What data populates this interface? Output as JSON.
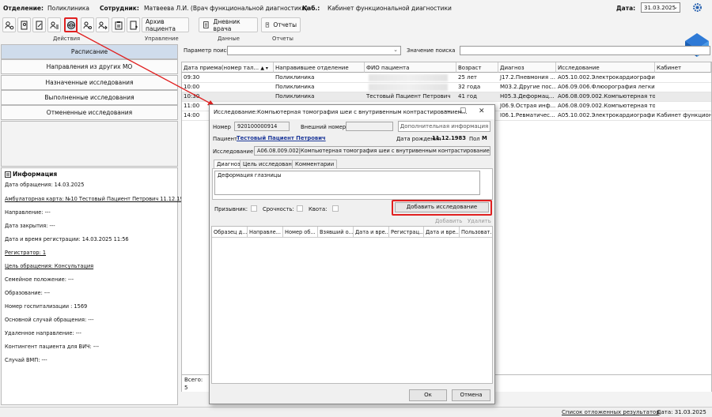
{
  "topbar": {
    "dept_label": "Отделение:",
    "dept_value": "Поликлиника",
    "emp_label": "Сотрудник:",
    "emp_value": "Матвеева Л.И. (Врач функциональной диагностики)",
    "cab_label": "Каб.:",
    "cab_value": "Кабинет функциональной диагностики",
    "date_label": "Дата:",
    "date_value": "31.03.2025"
  },
  "toolbar": {
    "groups": [
      "Действия",
      "Управление",
      "Данные",
      "Отчеты"
    ],
    "archive_label": "Архив пациента",
    "diary_label": "Дневник врача",
    "reports_label": "Отчеты"
  },
  "nav": {
    "items": [
      "Расписание",
      "Направления из других МО",
      "Назначенные исследования",
      "Выполненные исследования",
      "Отмененные исследования"
    ]
  },
  "info": {
    "header": "Информация",
    "lines": [
      "Дата обращения: 14.03.2025",
      "Амбулаторная карта: №10 Тестовый Пациент Петрович 11.12.1983",
      "Направление: ---",
      "Дата закрытия: ---",
      "Дата и время регистрации: 14.03.2025 11:56",
      "Регистратор: 1",
      "Цель обращения: Консультация",
      "Семейное положение: ---",
      "Образование: ---",
      "Номер госпитализации : 1569",
      "Основной случай обращения: ---",
      "Удаленное направление: ---",
      "Контингент пациента для ВИЧ: ---",
      "Случай ВМП: ---"
    ]
  },
  "search": {
    "param_label": "Параметр поиска",
    "value_label": "Значение поиска"
  },
  "grid": {
    "columns": [
      "Дата приема(номер тал...",
      "Направившее отделение",
      "ФИО пациента",
      "Возраст",
      "Диагноз",
      "Исследование",
      "Кабинет"
    ],
    "rows": [
      [
        "09:30",
        "Поликлиника",
        "",
        "25 лет",
        "J17.2.Пневмония ...",
        "A05.10.002.Электрокардиография",
        ""
      ],
      [
        "10:00",
        "Поликлиника",
        "",
        "32 года",
        "M03.2.Другие пос...",
        "A06.09.006.Флюорография легки...",
        ""
      ],
      [
        "10:30",
        "Поликлиника",
        "Тестовый Пациент Петрович",
        "41 год",
        "H05.3.Деформац...",
        "A06.08.009.002.Компьютерная то...",
        ""
      ],
      [
        "11:00",
        "",
        "",
        "",
        "J06.9.Острая инф...",
        "A06.08.009.002.Компьютерная то...",
        ""
      ],
      [
        "14:00",
        "",
        "",
        "",
        "I06.1.Ревматичес...",
        "A05.10.002.Электрокардиография",
        "Кабинет функцион"
      ]
    ],
    "footer_total": "Всего:",
    "footer_count": "5"
  },
  "status": {
    "link": "Список отложенных результатов",
    "date": "Дата: 31.03.2025"
  },
  "dialog": {
    "title": "Исследование:Компьютерная томография шеи с внутривенным контрастированием...",
    "number_label": "Номер",
    "number_value": "920100000914",
    "ext_label": "Внешний номер",
    "ext_value": "",
    "addinfo_btn": "Дополнительная информация",
    "patient_label": "Пациент",
    "patient_value": "Тестовый Пациент Петрович",
    "dob_label": "Дата рождения",
    "dob_value": "11.12.1983",
    "sex_label": "Пол",
    "sex_value": "М",
    "study_label": "Исследование",
    "study_value": "A06.08.009.002|Компьютерная томография шеи с внутривенным контрастированием",
    "tabs": [
      "Диагноз",
      "Цель исследования",
      "Комментарии"
    ],
    "diagnosis_text": "Деформация глазницы",
    "chk_labels": [
      "Призывник:",
      "Срочность:",
      "Квота:"
    ],
    "add_study_btn": "Добавить исследование",
    "add_link": "Добавить",
    "del_link": "Удалить",
    "columns": [
      "Образец д...",
      "Направле...",
      "Номер об...",
      "Взявший о...",
      "Дата и вре...",
      "Регистрац...",
      "Дата и вре...",
      "Пользоват..."
    ],
    "ok": "Ок",
    "cancel": "Отмена"
  }
}
